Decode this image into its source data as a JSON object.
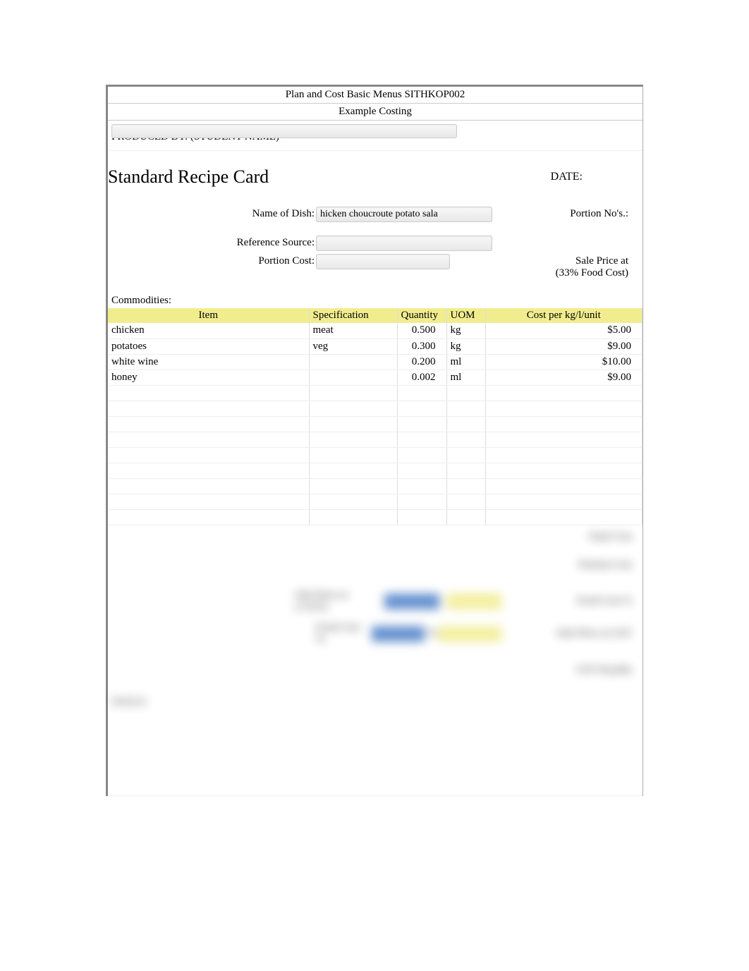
{
  "header": {
    "line1": "Plan and Cost Basic Menus SITHKOP002",
    "line2": "Example Costing"
  },
  "produced_by_label": "PRODUCED BY: (STUDENT NAME)",
  "title": "Standard Recipe Card",
  "date_label": "DATE:",
  "fields": {
    "name_of_dish_label": "Name of Dish:",
    "name_of_dish_value": "hicken choucroute potato sala",
    "portion_nos_label": "Portion No's.:",
    "reference_source_label": "Reference Source:",
    "portion_cost_label": "Portion Cost:",
    "sale_price_label_line1": "Sale Price at",
    "sale_price_label_line2": "(33% Food Cost)"
  },
  "commodities_label": "Commodities:",
  "table_headers": {
    "item": "Item",
    "specification": "Specification",
    "quantity": "Quantity",
    "uom": "UOM",
    "cost": "Cost per kg/l/unit"
  },
  "rows": [
    {
      "item": "chicken",
      "spec": "meat",
      "qty": "0.500",
      "uom": "kg",
      "cost": "$5.00"
    },
    {
      "item": "potatoes",
      "spec": "veg",
      "qty": "0.300",
      "uom": "kg",
      "cost": "$9.00"
    },
    {
      "item": "white wine",
      "spec": "",
      "qty": "0.200",
      "uom": "ml",
      "cost": "$10.00"
    },
    {
      "item": "honey",
      "spec": "",
      "qty": "0.002",
      "uom": "ml",
      "cost": "$9.00"
    }
  ],
  "summary": {
    "total_cost": "Total Cost",
    "portion_cost": "Portion Cost",
    "sale_price_gst_label": "Sale Price at (+GST)",
    "food_cost_pct_right": "Food Cost %",
    "food_cost_label": "Food Cost %",
    "pct_word": "%",
    "sale_price_gst_right": "Sale Price at GST",
    "gst_payable": "GST Payable"
  },
  "method_label": "Method:"
}
